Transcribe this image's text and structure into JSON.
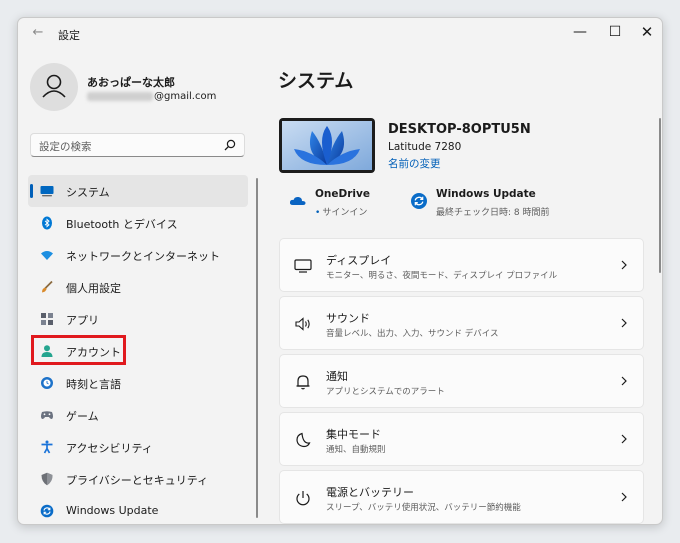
{
  "window": {
    "title": "設定",
    "back_glyph": "←",
    "min_glyph": "—",
    "max_glyph": "☐",
    "close_glyph": "✕"
  },
  "profile": {
    "name": "あおっぱーな太郎",
    "email_visible": "@gmail.com",
    "email_redacted": true
  },
  "search": {
    "placeholder": "設定の検索"
  },
  "sidebar": {
    "selected": "システム",
    "items": [
      {
        "label": "システム",
        "icon": "display-icon",
        "color": "#0067c0"
      },
      {
        "label": "Bluetooth とデバイス",
        "icon": "bluetooth-icon",
        "color": "#0078d4"
      },
      {
        "label": "ネットワークとインターネット",
        "icon": "wifi-icon",
        "color": "#1d8fe1"
      },
      {
        "label": "個人用設定",
        "icon": "paintbrush-icon",
        "color": "#c97f2b"
      },
      {
        "label": "アプリ",
        "icon": "apps-icon",
        "color": "#5a5f6b"
      },
      {
        "label": "アカウント",
        "icon": "account-icon",
        "color": "#25a58f"
      },
      {
        "label": "時刻と言語",
        "icon": "clock-globe-icon",
        "color": "#1d72c9"
      },
      {
        "label": "ゲーム",
        "icon": "gamepad-icon",
        "color": "#6b7280"
      },
      {
        "label": "アクセシビリティ",
        "icon": "accessibility-icon",
        "color": "#1a73d9"
      },
      {
        "label": "プライバシーとセキュリティ",
        "icon": "shield-icon",
        "color": "#6d7076"
      },
      {
        "label": "Windows Update",
        "icon": "windows-update-icon",
        "color": "#0a6cc8"
      }
    ]
  },
  "main": {
    "title": "システム",
    "device": {
      "name": "DESKTOP-8OPTU5N",
      "model": "Latitude 7280",
      "rename_link": "名前の変更"
    },
    "onedrive": {
      "title": "OneDrive",
      "status": "サインイン"
    },
    "windows_update": {
      "title": "Windows Update",
      "status": "最終チェック日時: 8 時間前"
    },
    "cards": [
      {
        "title": "ディスプレイ",
        "desc": "モニター、明るさ、夜間モード、ディスプレイ プロファイル",
        "icon": "monitor-icon"
      },
      {
        "title": "サウンド",
        "desc": "音量レベル、出力、入力、サウンド デバイス",
        "icon": "speaker-icon"
      },
      {
        "title": "通知",
        "desc": "アプリとシステムでのアラート",
        "icon": "bell-icon"
      },
      {
        "title": "集中モード",
        "desc": "通知、自動規則",
        "icon": "moon-icon"
      },
      {
        "title": "電源とバッテリー",
        "desc": "スリープ、バッテリ使用状況、バッテリー節約機能",
        "icon": "power-icon"
      }
    ]
  },
  "colors": {
    "accent": "#005fb8",
    "highlight_box": "#e0191e"
  }
}
